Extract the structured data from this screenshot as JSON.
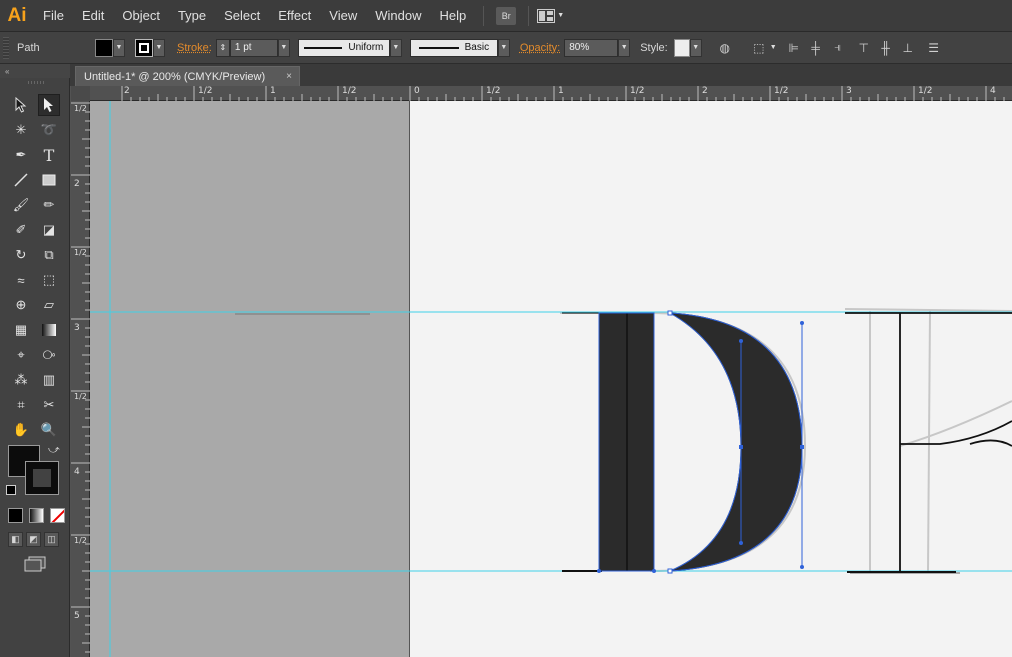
{
  "app": {
    "logo": "Ai"
  },
  "menu": [
    "File",
    "Edit",
    "Object",
    "Type",
    "Select",
    "Effect",
    "View",
    "Window",
    "Help"
  ],
  "menu_icons": {
    "bridge": "Br",
    "arrange": "arrange-documents-icon"
  },
  "control": {
    "selection_label": "Path",
    "stroke_label": "Stroke:",
    "stroke_weight": "1 pt",
    "profile": "Uniform",
    "brush": "Basic",
    "opacity_label": "Opacity:",
    "opacity_value": "80%",
    "style_label": "Style:"
  },
  "document": {
    "tab_title": "Untitled-1* @ 200% (CMYK/Preview)",
    "close_glyph": "×"
  },
  "rulers": {
    "top": [
      "2",
      "1/2",
      "1",
      "1/2",
      "0",
      "1/2",
      "1",
      "1/2",
      "2",
      "1/2",
      "3",
      "1/2",
      "4"
    ],
    "left": [
      "1/2",
      "2",
      "1/2",
      "3",
      "1/2",
      "4",
      "1/2",
      "5"
    ]
  },
  "colors": {
    "accent": "#f7a21b",
    "guide": "#3fd1e8",
    "selection": "#2f62d9",
    "letter_fill": "#2b2b2b",
    "pasteboard": "#a9a9a9",
    "artboard": "#f3f3f3"
  }
}
